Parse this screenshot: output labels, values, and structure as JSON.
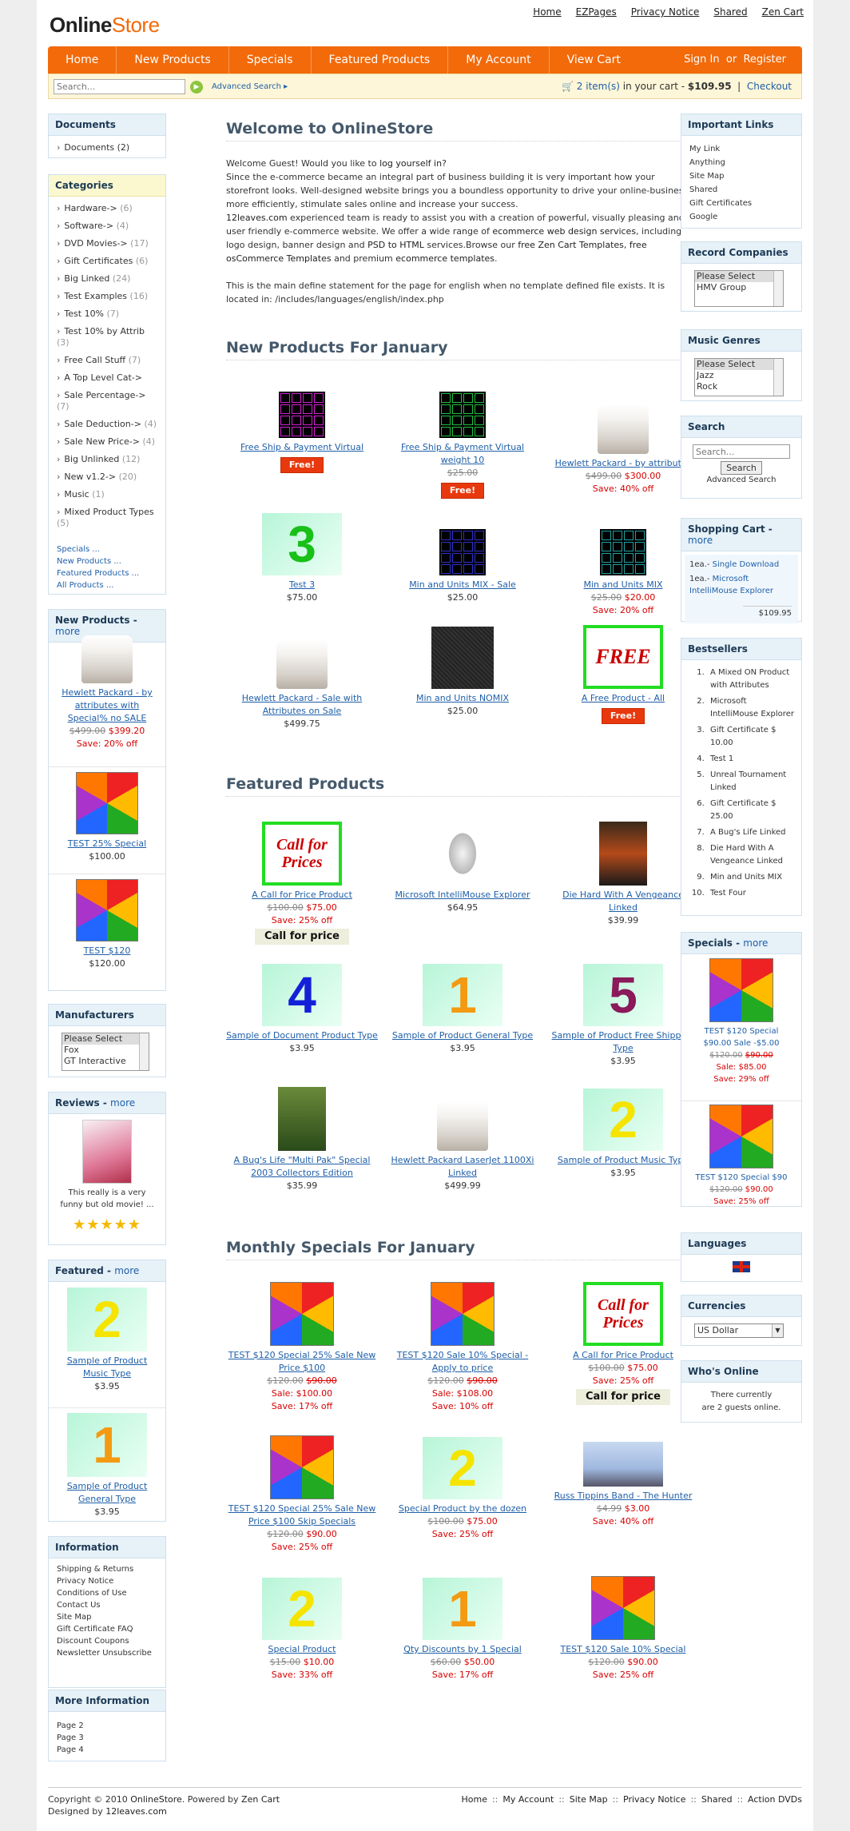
{
  "logo": {
    "a": "Online",
    "b": "Store"
  },
  "toplinks": [
    "Home",
    "EZPages",
    "Privacy Notice",
    "Shared",
    "Zen Cart"
  ],
  "nav": [
    "Home",
    "New Products",
    "Specials",
    "Featured Products",
    "My Account",
    "View Cart"
  ],
  "nav_right": {
    "signin": "Sign In",
    "or": "or",
    "register": "Register"
  },
  "search": {
    "placeholder": "Search...",
    "advanced": "Advanced Search ▸",
    "cart_items": "2 item(s)",
    "cart_mid": " in your cart - ",
    "cart_total": "$109.95",
    "checkout": "Checkout"
  },
  "documents": {
    "title": "Documents",
    "items": [
      {
        "name": "Documents",
        "count": "(2)"
      }
    ]
  },
  "categories": {
    "title": "Categories",
    "items": [
      {
        "name": "Hardware->",
        "count": "(6)"
      },
      {
        "name": "Software->",
        "count": "(4)"
      },
      {
        "name": "DVD Movies->",
        "count": "(17)"
      },
      {
        "name": "Gift Certificates",
        "count": "(6)"
      },
      {
        "name": "Big Linked",
        "count": "(24)"
      },
      {
        "name": "Test Examples",
        "count": "(16)"
      },
      {
        "name": "Test 10%",
        "count": "(7)"
      },
      {
        "name": "Test 10% by Attrib",
        "count": "(3)"
      },
      {
        "name": "Free Call Stuff",
        "count": "(7)"
      },
      {
        "name": "A Top Level Cat->",
        "count": ""
      },
      {
        "name": "Sale Percentage->",
        "count": "(7)"
      },
      {
        "name": "Sale Deduction->",
        "count": "(4)"
      },
      {
        "name": "Sale New Price->",
        "count": "(4)"
      },
      {
        "name": "Big Unlinked",
        "count": "(12)"
      },
      {
        "name": "New v1.2->",
        "count": "(20)"
      },
      {
        "name": "Music",
        "count": "(1)"
      },
      {
        "name": "Mixed Product Types",
        "count": "(5)"
      }
    ],
    "links": [
      "Specials ...",
      "New Products ...",
      "Featured Products ...",
      "All Products ..."
    ]
  },
  "left_new": {
    "title": "New Products - ",
    "more": "more",
    "items": [
      {
        "name": "Hewlett Packard - by attributes with Special% no SALE",
        "old": "$499.00",
        "price": "$399.20",
        "save": "Save: 20% off"
      },
      {
        "name": "TEST 25% Special",
        "price": "$100.00"
      },
      {
        "name": "TEST $120",
        "price": "$120.00"
      }
    ]
  },
  "manufacturers": {
    "title": "Manufacturers",
    "options": [
      "Please Select",
      "Fox",
      "GT Interactive"
    ]
  },
  "reviews": {
    "title": "Reviews - ",
    "more": "more",
    "text": "This really is a very funny but old movie! ...",
    "stars": "★★★★★"
  },
  "left_featured": {
    "title": "Featured - ",
    "more": "more",
    "items": [
      {
        "name": "Sample of Product Music Type",
        "price": "$3.95"
      },
      {
        "name": "Sample of Product General Type",
        "price": "$3.95"
      }
    ]
  },
  "information": {
    "title": "Information",
    "items": [
      "Shipping & Returns",
      "Privacy Notice",
      "Conditions of Use",
      "Contact Us",
      "Site Map",
      "Gift Certificate FAQ",
      "Discount Coupons",
      "Newsletter Unsubscribe"
    ]
  },
  "more_info": {
    "title": "More Information",
    "items": [
      "Page 2",
      "Page 3",
      "Page 4"
    ]
  },
  "welcome": {
    "title": "Welcome to OnlineStore",
    "p1a": "Welcome Guest! Would you like to ",
    "p1link": "log yourself in",
    "p1b": "?",
    "p2": "Since the e-commerce became an integral part of business building it is very important how your storefront looks. Well-designed website brings you a boundless opportunity to drive your online-business more efficiently, stimulate sales online and increase your success.",
    "p3a": "12leaves.com",
    "p3b": " experienced team is ready to assist you with a creation of powerful, visually pleasing and user friendly e-commerce website. We offer a wide range of ",
    "l1": "ecommerce web design services",
    "p3c": ", including logo design, banner design and ",
    "l2": "PSD to HTML",
    "p3d": " services.Browse our ",
    "l3": "free Zen Cart Templates",
    "p3e": ", ",
    "l4": "free osCommerce Templates",
    "p3f": " and premium ",
    "l5": "ecommerce templates",
    "p3g": ".",
    "p4": "This is the main define statement for the page for english when no template defined file exists. It is located in: /includes/languages/english/index.php"
  },
  "new_products": {
    "title": "New Products For January",
    "items": [
      {
        "name": "Free Ship & Payment Virtual",
        "badge": "Free!"
      },
      {
        "name": "Free Ship & Payment Virtual weight 10",
        "old": "$25.00",
        "badge": "Free!"
      },
      {
        "name": "Hewlett Packard - by attributes",
        "old": "$499.00",
        "price": "$300.00",
        "save": "Save: 40% off"
      },
      {
        "name": "Test 3",
        "price": "$75.00",
        "num": "3"
      },
      {
        "name": "Min and Units MIX - Sale",
        "price": "$25.00"
      },
      {
        "name": "Min and Units MIX",
        "old": "$25.00",
        "price": "$20.00",
        "save": "Save: 20% off"
      },
      {
        "name": "Hewlett Packard - Sale with Attributes on Sale",
        "price": "$499.75"
      },
      {
        "name": "Min and Units NOMIX",
        "price": "$25.00"
      },
      {
        "name": "A Free Product - All",
        "badge": "Free!",
        "img": "FREE"
      }
    ]
  },
  "featured": {
    "title": "Featured Products",
    "items": [
      {
        "name": "A Call for Price Product",
        "old": "$100.00",
        "price": "$75.00",
        "save": "Save: 25% off",
        "cfp": "Call for price",
        "img": "Call for Prices"
      },
      {
        "name": "Microsoft IntelliMouse Explorer",
        "price": "$64.95"
      },
      {
        "name": "Die Hard With A Vengeance Linked",
        "price": "$39.99"
      },
      {
        "name": "Sample of Document Product Type",
        "price": "$3.95",
        "num": "4"
      },
      {
        "name": "Sample of Product General Type",
        "price": "$3.95",
        "num": "1"
      },
      {
        "name": "Sample of Product Free Shipping Type",
        "price": "$3.95",
        "num": "5"
      },
      {
        "name": "A Bug's Life \"Multi Pak\" Special 2003 Collectors Edition",
        "price": "$35.99"
      },
      {
        "name": "Hewlett Packard LaserJet 1100Xi Linked",
        "price": "$499.99"
      },
      {
        "name": "Sample of Product Music Type",
        "price": "$3.95",
        "num": "2"
      }
    ]
  },
  "specials": {
    "title": "Monthly Specials For January",
    "items": [
      {
        "name": "TEST $120 Special 25% Sale New Price $100",
        "old": "$120.00",
        "old2": "$90.00",
        "price": "",
        "sale": "Sale: $100.00",
        "save": "Save: 17% off"
      },
      {
        "name": "TEST $120 Sale 10% Special - Apply to price",
        "old": "$120.00",
        "old2": "$90.00",
        "sale": "Sale: $108.00",
        "save": "Save: 10% off"
      },
      {
        "name": "A Call for Price Product",
        "old": "$100.00",
        "price": "$75.00",
        "save": "Save: 25% off",
        "cfp": "Call for price",
        "img": "Call for Prices"
      },
      {
        "name": "TEST $120 Special 25% Sale New Price $100 Skip Specials",
        "old": "$120.00",
        "price": "$90.00",
        "save": "Save: 25% off"
      },
      {
        "name": "Special Product by the dozen",
        "old": "$100.00",
        "price": "$75.00",
        "save": "Save: 25% off",
        "num": "2"
      },
      {
        "name": "Russ Tippins Band - The Hunter",
        "old": "$4.99",
        "price": "$3.00",
        "save": "Save: 40% off"
      },
      {
        "name": "Special Product",
        "old": "$15.00",
        "price": "$10.00",
        "save": "Save: 33% off",
        "num": "2"
      },
      {
        "name": "Qty Discounts by 1 Special",
        "old": "$60.00",
        "price": "$50.00",
        "save": "Save: 17% off",
        "num": "1"
      },
      {
        "name": "TEST $120 Sale 10% Special",
        "old": "$120.00",
        "price": "$90.00",
        "save": "Save: 25% off"
      }
    ]
  },
  "important": {
    "title": "Important Links",
    "items": [
      "My Link",
      "Anything",
      "Site Map",
      "Shared",
      "Gift Certificates",
      "Google"
    ]
  },
  "record": {
    "title": "Record Companies",
    "options": [
      "Please Select",
      "HMV Group"
    ]
  },
  "genres": {
    "title": "Music Genres",
    "options": [
      "Please Select",
      "Jazz",
      "Rock"
    ]
  },
  "rsearch": {
    "title": "Search",
    "placeholder": "Search...",
    "button": "Search",
    "advanced": "Advanced Search"
  },
  "shopcart": {
    "title": "Shopping Cart - ",
    "more": "more",
    "items": [
      {
        "qty": "1ea.-",
        "name": "Single Download"
      },
      {
        "qty": "1ea.-",
        "name": "Microsoft IntelliMouse Explorer"
      }
    ],
    "total": "$109.95"
  },
  "bestsellers": {
    "title": "Bestsellers",
    "items": [
      "A Mixed ON Product with Attributes",
      "Microsoft IntelliMouse Explorer",
      "Gift Certificate $ 10.00",
      "Test 1",
      "Unreal Tournament Linked",
      "Gift Certificate $ 25.00",
      "A Bug's Life Linked",
      "Die Hard With A Vengeance Linked",
      "Min and Units MIX",
      "Test Four"
    ]
  },
  "rspecials": {
    "title": "Specials - ",
    "more": "more",
    "items": [
      {
        "name": "TEST $120 Special $90.00 Sale -$5.00",
        "old": "$120.00",
        "old2": "$90.00",
        "sale": "Sale: $85.00",
        "save": "Save: 29% off"
      },
      {
        "name": "TEST $120 Special $90",
        "old": "$120.00",
        "price": "$90.00",
        "save": "Save: 25% off"
      }
    ]
  },
  "languages": {
    "title": "Languages"
  },
  "currencies": {
    "title": "Currencies",
    "value": "US Dollar"
  },
  "whos": {
    "title": "Who's Online",
    "text1": "There currently",
    "text2": "are 2 guests online."
  },
  "footer": {
    "c1": "Copyright © 2010 ",
    "store": "OnlineStore",
    "c2": ". Powered by ",
    "zen": "Zen Cart",
    "d1": "Designed by ",
    "d2": "12leaves.com",
    "links": [
      "Home",
      "My Account",
      "Site Map",
      "Privacy Notice",
      "Shared",
      "Action DVDs"
    ]
  }
}
